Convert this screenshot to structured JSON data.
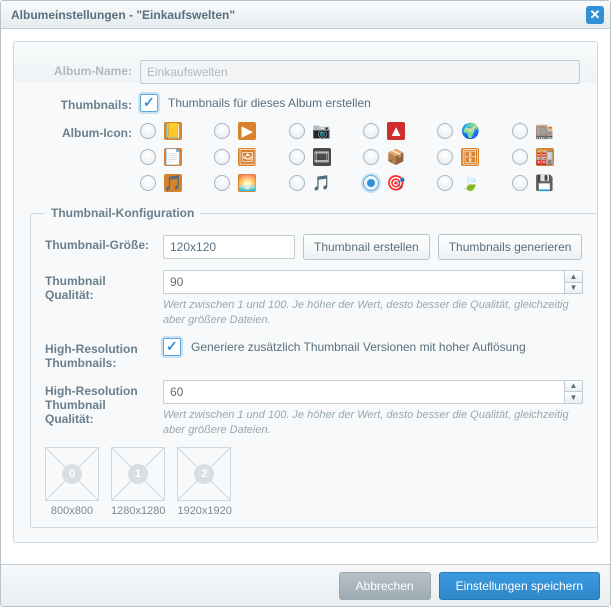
{
  "window": {
    "title": "Albumeinstellungen - \"Einkaufswelten\""
  },
  "form": {
    "album_name_label": "Album-Name:",
    "album_name_value": "Einkaufswelten",
    "thumbnails_label": "Thumbnails:",
    "thumbnails_checked": true,
    "thumbnails_text": "Thumbnails für dieses Album erstellen",
    "album_icon_label": "Album-Icon:"
  },
  "icons": [
    {
      "id": "book",
      "emoji": "📒",
      "cls": "ic-orange"
    },
    {
      "id": "play",
      "emoji": "▶",
      "cls": "ic-orange"
    },
    {
      "id": "camera",
      "emoji": "📷",
      "cls": "ic-plain"
    },
    {
      "id": "pdf",
      "emoji": "▲",
      "cls": "ic-red"
    },
    {
      "id": "globe",
      "emoji": "🌍",
      "cls": "ic-plain"
    },
    {
      "id": "shop",
      "emoji": "🏬",
      "cls": "ic-plain"
    },
    {
      "id": "note",
      "emoji": "📄",
      "cls": "ic-orange"
    },
    {
      "id": "image",
      "emoji": "🖼",
      "cls": "ic-orange"
    },
    {
      "id": "film",
      "emoji": "🎞",
      "cls": "ic-dark"
    },
    {
      "id": "box",
      "emoji": "📦",
      "cls": "ic-plain"
    },
    {
      "id": "drawer",
      "emoji": "🗄",
      "cls": "ic-orange"
    },
    {
      "id": "factory",
      "emoji": "🏭",
      "cls": "ic-orange"
    },
    {
      "id": "music1",
      "emoji": "🎵",
      "cls": "ic-orange"
    },
    {
      "id": "sunset",
      "emoji": "🌅",
      "cls": "ic-orange"
    },
    {
      "id": "music2",
      "emoji": "🎵",
      "cls": "ic-plain"
    },
    {
      "id": "target",
      "emoji": "🎯",
      "cls": "ic-plain",
      "selected": true
    },
    {
      "id": "leaf",
      "emoji": "🍃",
      "cls": "ic-plain"
    },
    {
      "id": "save",
      "emoji": "💾",
      "cls": "ic-plain"
    }
  ],
  "group": {
    "legend": "Thumbnail-Konfiguration",
    "size_label": "Thumbnail-Größe:",
    "size_value": "120x120",
    "create_btn": "Thumbnail erstellen",
    "generate_btn": "Thumbnails generieren",
    "quality_label": "Thumbnail Qualität:",
    "quality_value": "90",
    "quality_help": "Wert zwischen 1 und 100. Je höher der Wert, desto besser die Qualität, gleichzeitig aber größere Dateien.",
    "highres_label": "High-Resolution Thumbnails:",
    "highres_checked": true,
    "highres_text": "Generiere zusätzlich Thumbnail Versionen mit hoher Auflösung",
    "highres_quality_label": "High-Resolution Thumbnail Qualität:",
    "highres_quality_value": "60",
    "highres_quality_help": "Wert zwischen 1 und 100. Je höher der Wert, desto besser die Qualität, gleichzeitig aber größere Dateien."
  },
  "sizes": [
    {
      "idx": "0",
      "label": "800x800"
    },
    {
      "idx": "1",
      "label": "1280x1280"
    },
    {
      "idx": "2",
      "label": "1920x1920"
    }
  ],
  "footer": {
    "cancel": "Abbrechen",
    "save": "Einstellungen speichern"
  }
}
